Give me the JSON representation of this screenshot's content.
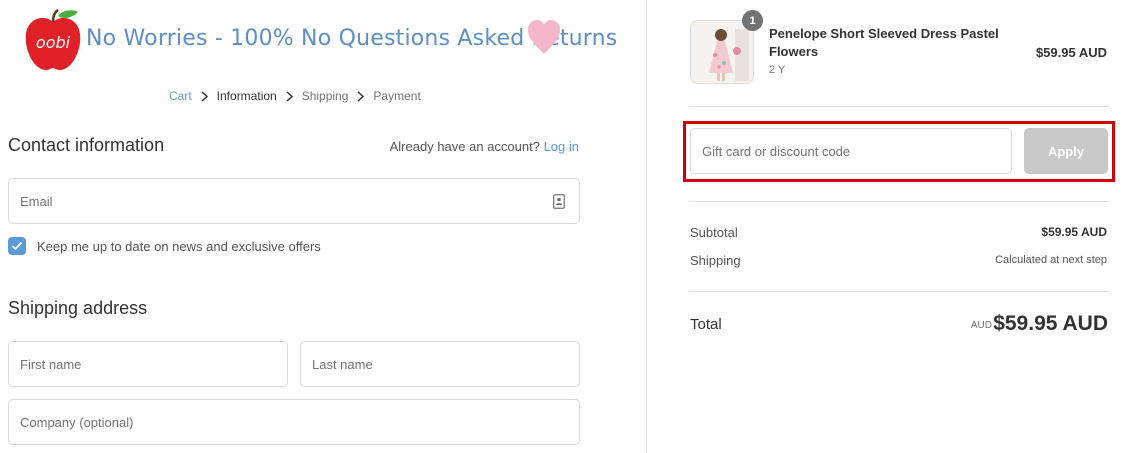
{
  "header": {
    "logo_brand": "oobi",
    "banner_text": "No Worries - 100% No Questions Asked Returns"
  },
  "breadcrumb": [
    {
      "label": "Cart",
      "state": "link"
    },
    {
      "label": "Information",
      "state": "active"
    },
    {
      "label": "Shipping",
      "state": "upcoming"
    },
    {
      "label": "Payment",
      "state": "upcoming"
    }
  ],
  "contact": {
    "title": "Contact information",
    "account_prompt": "Already have an account?",
    "login_link": "Log in",
    "email_placeholder": "Email",
    "newsletter_label": "Keep me up to date on news and exclusive offers",
    "newsletter_checked": true
  },
  "shipping_address": {
    "title": "Shipping address",
    "first_name_placeholder": "First name",
    "last_name_placeholder": "Last name",
    "company_placeholder": "Company (optional)"
  },
  "order_summary": {
    "product": {
      "name": "Penelope Short Sleeved Dress Pastel Flowers",
      "variant": "2 Y",
      "price": "$59.95 AUD",
      "quantity": "1"
    },
    "discount": {
      "placeholder": "Gift card or discount code",
      "apply_label": "Apply"
    },
    "subtotal_label": "Subtotal",
    "subtotal_value": "$59.95 AUD",
    "shipping_label": "Shipping",
    "shipping_value": "Calculated at next step",
    "total_label": "Total",
    "total_currency": "AUD",
    "total_value": "$59.95 AUD"
  },
  "colors": {
    "accent": "#5a9bd5",
    "highlight": "#d0000a",
    "apply_disabled": "#c8c8c8",
    "logo_red": "#e02027"
  }
}
